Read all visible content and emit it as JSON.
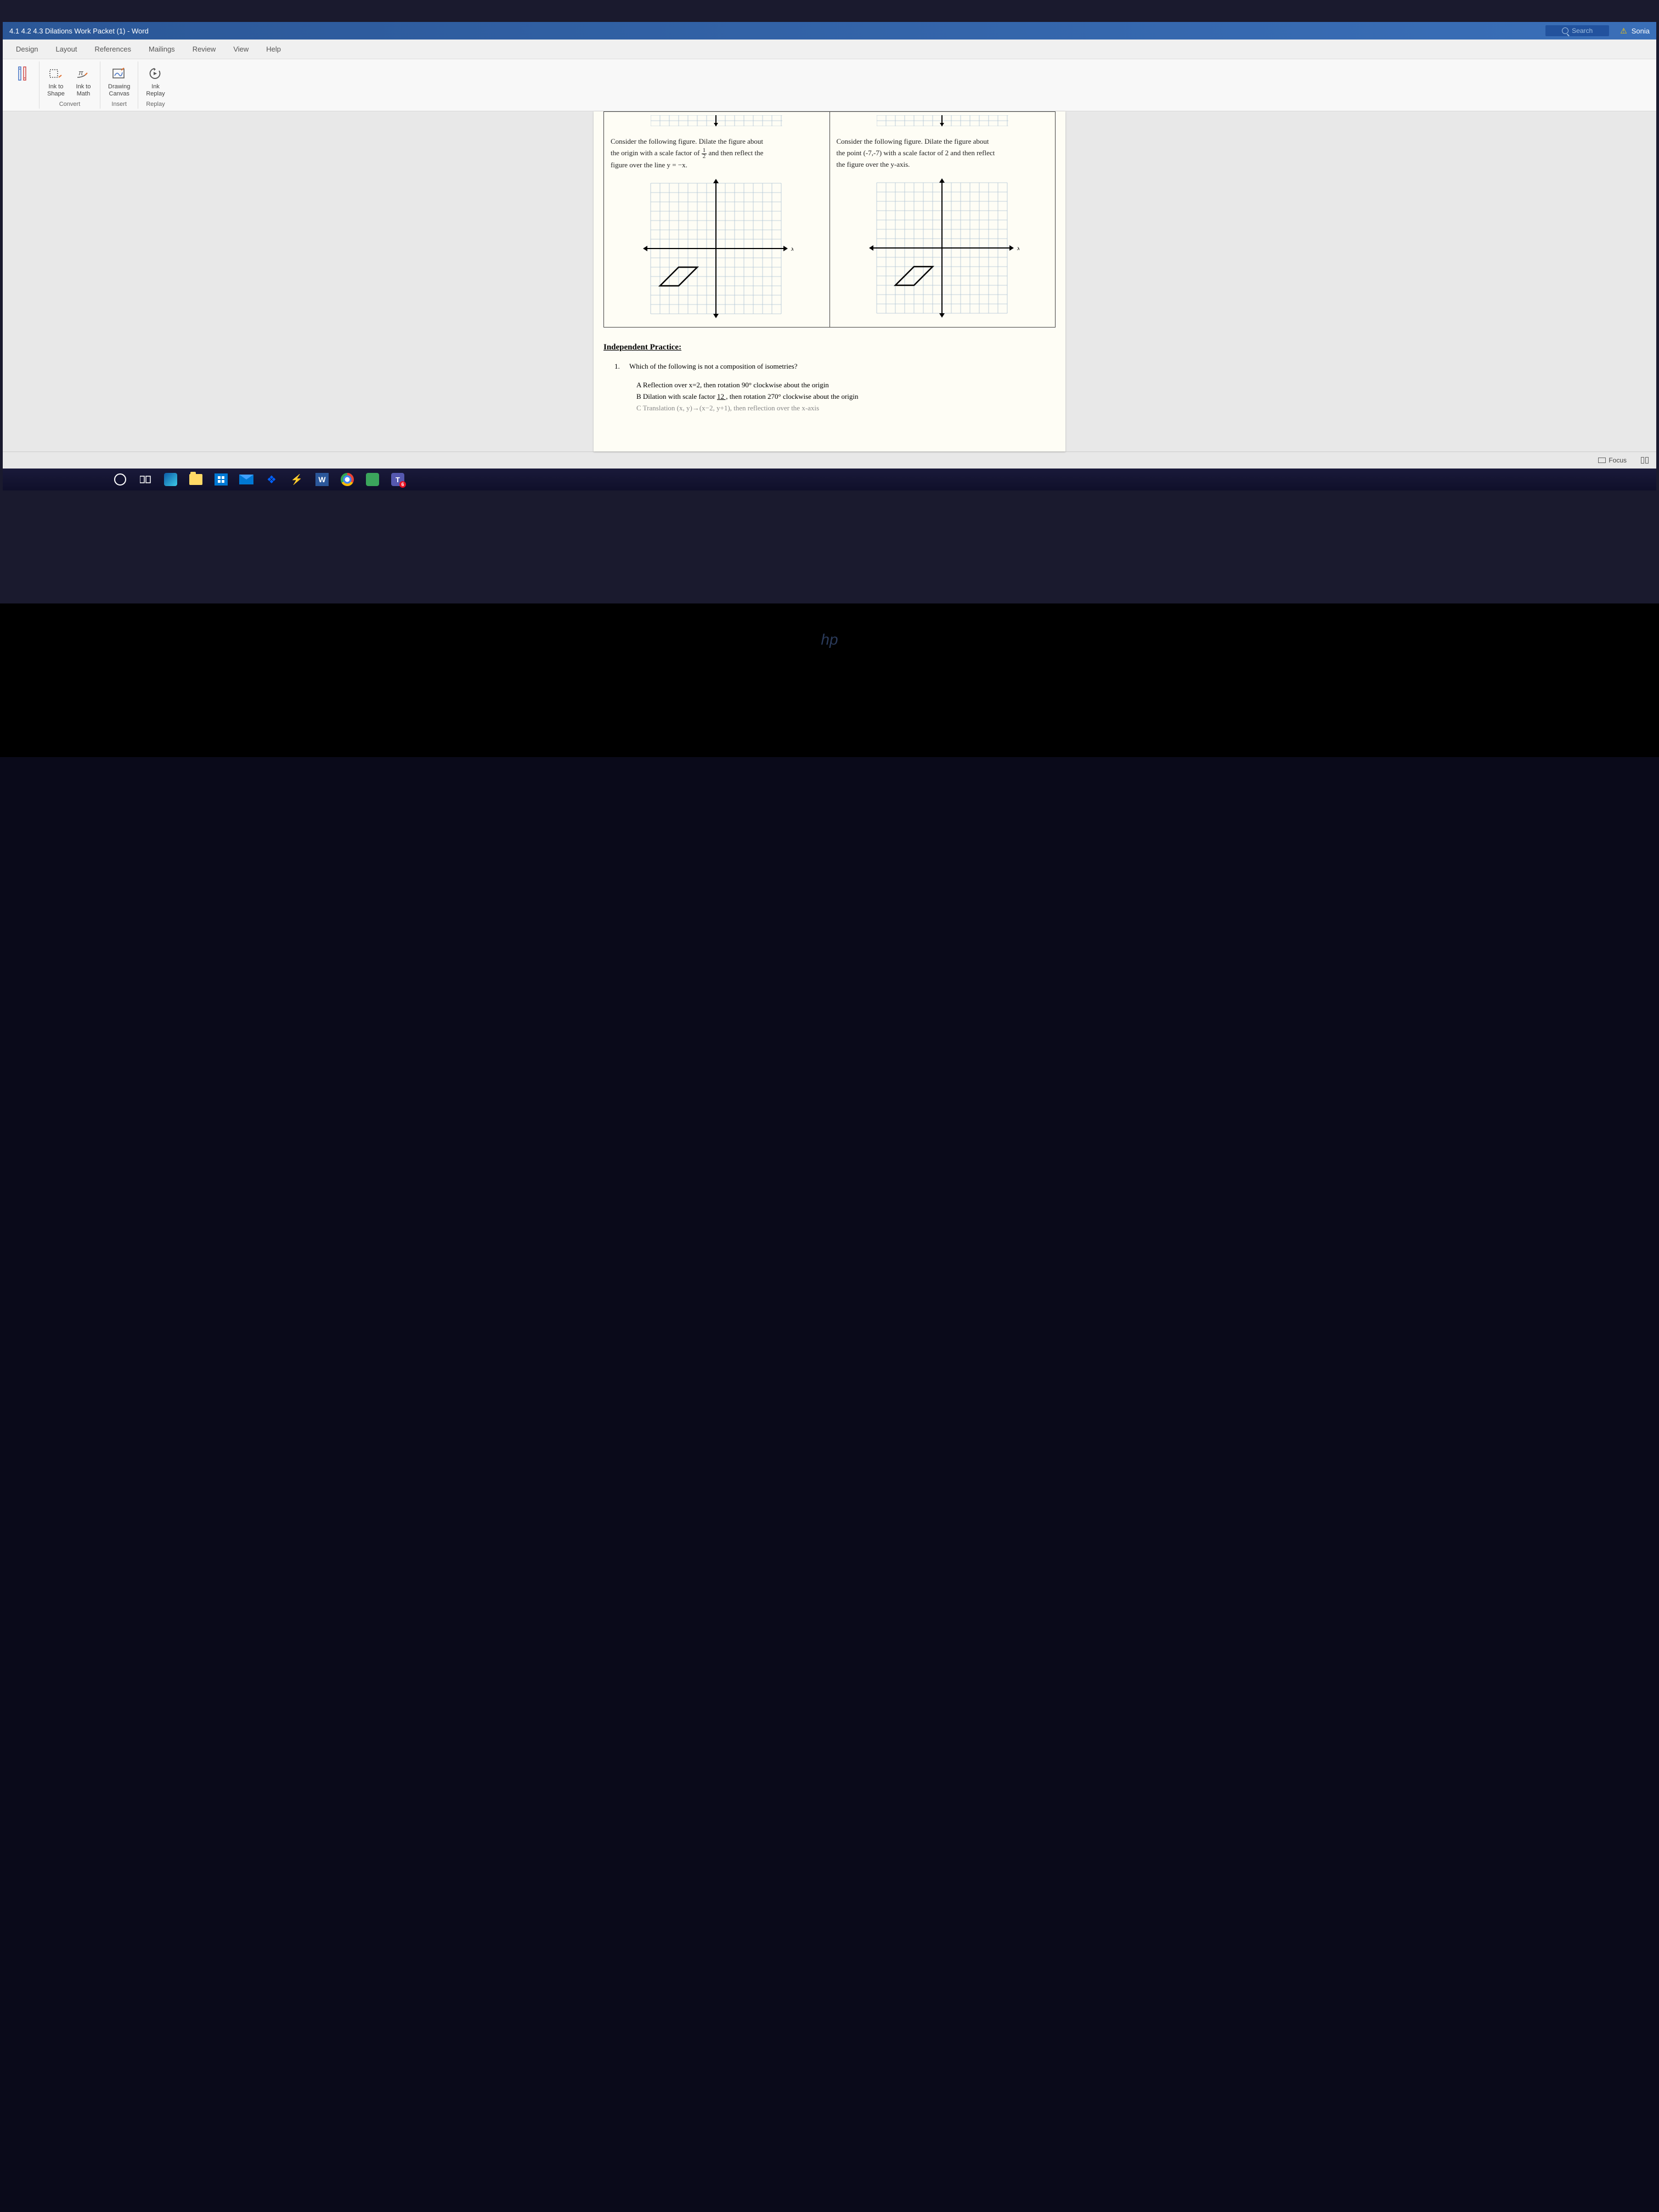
{
  "app": {
    "title": "4.1 4.2 4.3 Dilations Work Packet (1) - Word",
    "search_placeholder": "Search",
    "user_name": "Sonia"
  },
  "tabs": {
    "design": "Design",
    "layout": "Layout",
    "references": "References",
    "mailings": "Mailings",
    "review": "Review",
    "view": "View",
    "help": "Help"
  },
  "ribbon": {
    "ink_to_shape": "Ink to\nShape",
    "ink_to_math": "Ink to\nMath",
    "drawing_canvas": "Drawing\nCanvas",
    "ink_replay": "Ink\nReplay",
    "group_convert": "Convert",
    "group_insert": "Insert",
    "group_replay": "Replay"
  },
  "problem_left": {
    "line1": "Consider the following figure. Dilate the figure about",
    "line2_before": "the origin with a scale factor of ",
    "frac_num": "1",
    "frac_den": "2",
    "line2_after": " and then reflect the",
    "line3": "figure over the line y = −x.",
    "axis_x": "x"
  },
  "problem_right": {
    "line1": "Consider the following figure. Dilate the figure about",
    "line2": "the point (-7,-7) with a scale factor of 2 and then reflect",
    "line3": "the figure over the y-axis.",
    "axis_x": "x"
  },
  "practice": {
    "heading": "Independent Practice:",
    "q1_num": "1.",
    "q1_text": "Which of the following is not a composition of isometries?",
    "ans_a": "A Reflection over x=2, then rotation 90° clockwise about the origin",
    "ans_b_before": "B Dilation with scale factor ",
    "ans_b_underline": "12 ,",
    "ans_b_after": " then rotation 270° clockwise about the origin",
    "ans_c": "C Translation (x, y)→(x−2, y+1), then reflection over the x-axis"
  },
  "status": {
    "focus": "Focus"
  },
  "taskbar": {
    "word_letter": "W",
    "teams_letter": "T",
    "teams_badge": "6"
  },
  "bezel": {
    "logo": "hp"
  },
  "chart_data": {
    "left_figure": {
      "type": "parallelogram_on_grid",
      "grid_range_x": [
        -7,
        7
      ],
      "grid_range_y": [
        -7,
        7
      ],
      "vertices": [
        [
          -6,
          -4
        ],
        [
          -4,
          -2
        ],
        [
          -2,
          -2
        ],
        [
          -4,
          -4
        ]
      ],
      "note": "approximate vertices of black parallelogram in lower-left quadrant"
    },
    "right_figure": {
      "type": "parallelogram_on_grid",
      "grid_range_x": [
        -7,
        7
      ],
      "grid_range_y": [
        -7,
        7
      ],
      "vertices": [
        [
          -5,
          -4
        ],
        [
          -3,
          -2
        ],
        [
          -1,
          -2
        ],
        [
          -3,
          -4
        ]
      ],
      "note": "approximate vertices of black parallelogram in lower-left quadrant"
    }
  }
}
